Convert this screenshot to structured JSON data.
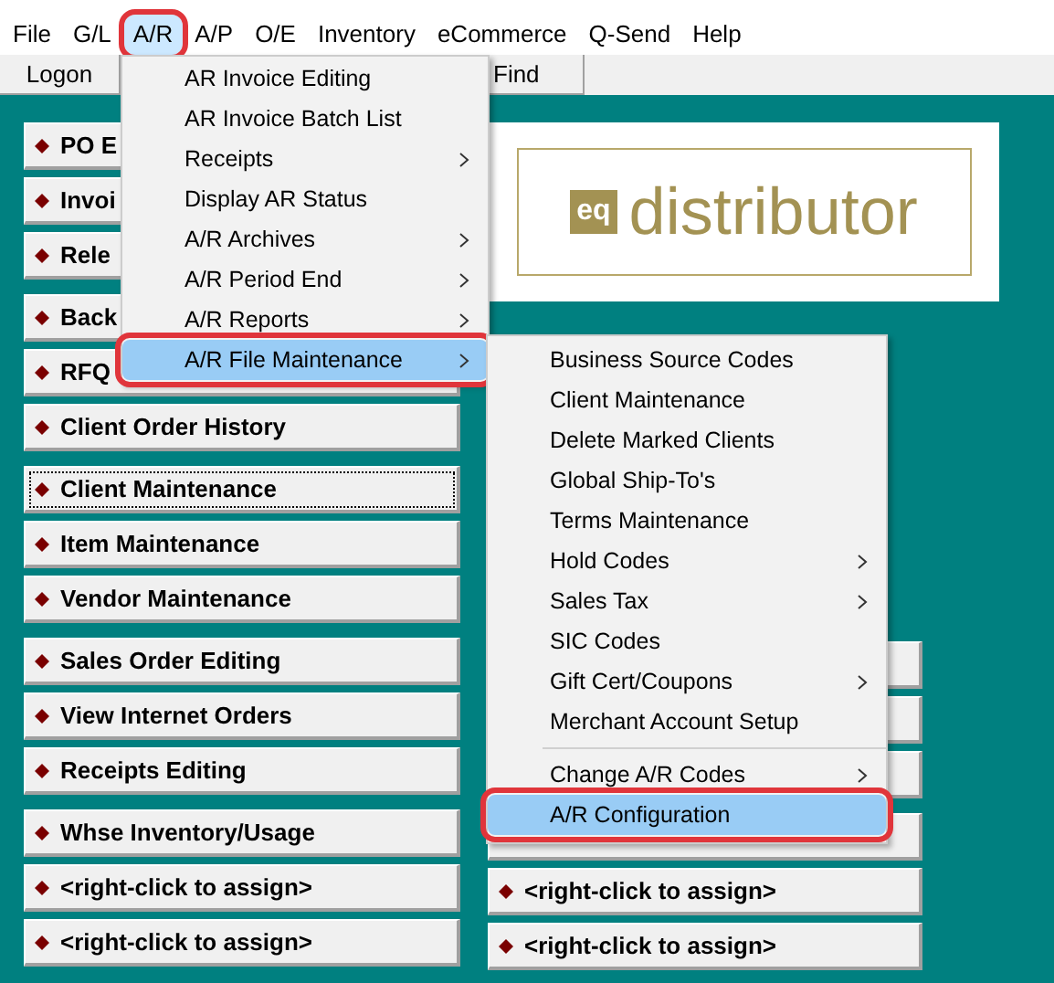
{
  "menubar": [
    {
      "label": "File",
      "selected": false,
      "annotated": false
    },
    {
      "label": "G/L",
      "selected": false,
      "annotated": false
    },
    {
      "label": "A/R",
      "selected": true,
      "annotated": true
    },
    {
      "label": "A/P",
      "selected": false,
      "annotated": false
    },
    {
      "label": "O/E",
      "selected": false,
      "annotated": false
    },
    {
      "label": "Inventory",
      "selected": false,
      "annotated": false
    },
    {
      "label": "eCommerce",
      "selected": false,
      "annotated": false
    },
    {
      "label": "Q-Send",
      "selected": false,
      "annotated": false
    },
    {
      "label": "Help",
      "selected": false,
      "annotated": false
    }
  ],
  "toolbar": [
    {
      "label": "Logon"
    },
    {
      "label": "Find"
    }
  ],
  "logo": {
    "mark": "eq",
    "text": "distributor"
  },
  "left_groups": [
    [
      {
        "label": "PO E",
        "focused": false
      },
      {
        "label": "Invoi",
        "focused": false
      },
      {
        "label": "Rele",
        "focused": false
      }
    ],
    [
      {
        "label": "Back",
        "focused": false
      },
      {
        "label": "RFQ",
        "focused": false
      },
      {
        "label": "Client Order History",
        "focused": false
      }
    ],
    [
      {
        "label": "Client Maintenance",
        "focused": true
      },
      {
        "label": "Item Maintenance",
        "focused": false
      },
      {
        "label": "Vendor Maintenance",
        "focused": false
      }
    ],
    [
      {
        "label": "Sales Order Editing",
        "focused": false
      },
      {
        "label": "View Internet Orders",
        "focused": false
      },
      {
        "label": "Receipts Editing",
        "focused": false
      }
    ],
    [
      {
        "label": "Whse Inventory/Usage",
        "focused": false
      },
      {
        "label": "<right-click to assign>",
        "focused": false
      },
      {
        "label": "<right-click to assign>",
        "focused": false
      }
    ]
  ],
  "right_groups": [
    [
      {
        "kind": "blank"
      },
      {
        "kind": "blank"
      },
      {
        "kind": "blank"
      }
    ],
    [
      {
        "kind": "blank"
      },
      {
        "kind": "shortcut",
        "label": "<right-click to assign>"
      },
      {
        "kind": "shortcut",
        "label": "<right-click to assign>"
      }
    ]
  ],
  "ar_menu": [
    {
      "label": "AR Invoice Editing",
      "submenu": false,
      "selected": false,
      "annotated": false
    },
    {
      "label": "AR Invoice Batch List",
      "submenu": false,
      "selected": false,
      "annotated": false
    },
    {
      "label": "Receipts",
      "submenu": true,
      "selected": false,
      "annotated": false
    },
    {
      "label": "Display AR Status",
      "submenu": false,
      "selected": false,
      "annotated": false
    },
    {
      "label": "A/R Archives",
      "submenu": true,
      "selected": false,
      "annotated": false
    },
    {
      "label": "A/R Period End",
      "submenu": true,
      "selected": false,
      "annotated": false
    },
    {
      "label": "A/R Reports",
      "submenu": true,
      "selected": false,
      "annotated": false
    },
    {
      "label": "A/R File Maintenance",
      "submenu": true,
      "selected": true,
      "annotated": true
    }
  ],
  "submenu": [
    {
      "kind": "item",
      "label": "Business Source Codes",
      "submenu": false,
      "selected": false,
      "annotated": false
    },
    {
      "kind": "item",
      "label": "Client Maintenance",
      "submenu": false,
      "selected": false,
      "annotated": false
    },
    {
      "kind": "item",
      "label": "Delete Marked Clients",
      "submenu": false,
      "selected": false,
      "annotated": false
    },
    {
      "kind": "item",
      "label": "Global Ship-To's",
      "submenu": false,
      "selected": false,
      "annotated": false
    },
    {
      "kind": "item",
      "label": "Terms Maintenance",
      "submenu": false,
      "selected": false,
      "annotated": false
    },
    {
      "kind": "item",
      "label": "Hold Codes",
      "submenu": true,
      "selected": false,
      "annotated": false
    },
    {
      "kind": "item",
      "label": "Sales Tax",
      "submenu": true,
      "selected": false,
      "annotated": false
    },
    {
      "kind": "item",
      "label": "SIC Codes",
      "submenu": false,
      "selected": false,
      "annotated": false
    },
    {
      "kind": "item",
      "label": "Gift Cert/Coupons",
      "submenu": true,
      "selected": false,
      "annotated": false
    },
    {
      "kind": "item",
      "label": "Merchant Account Setup",
      "submenu": false,
      "selected": false,
      "annotated": false
    },
    {
      "kind": "separator"
    },
    {
      "kind": "item",
      "label": "Change A/R Codes",
      "submenu": true,
      "selected": false,
      "annotated": false
    },
    {
      "kind": "item",
      "label": "A/R Configuration",
      "submenu": false,
      "selected": true,
      "annotated": true
    }
  ]
}
